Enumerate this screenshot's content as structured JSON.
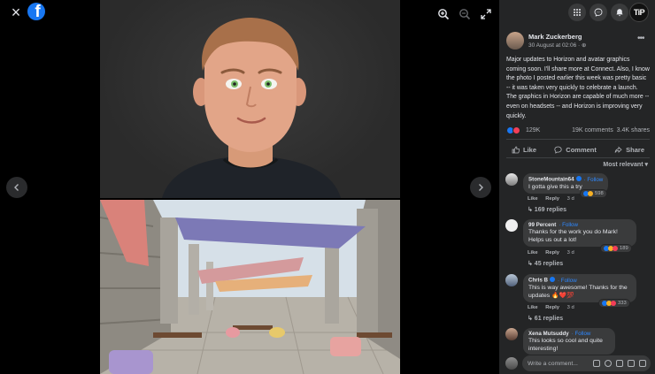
{
  "viewer": {
    "logo_letter": "f",
    "close_icon": "×",
    "tools": [
      "zoom-in-icon",
      "zoom-out-icon",
      "fullscreen-icon"
    ]
  },
  "topbar": {
    "buttons": [
      "menu-grid-icon",
      "messenger-icon",
      "notifications-icon"
    ],
    "account_label": "TiP"
  },
  "post": {
    "author": "Mark Zuckerberg",
    "date": "30 August at 02:06 · ",
    "audience_icon": "globe-icon",
    "more_icon": "•••",
    "text": "Major updates to Horizon and avatar graphics coming soon. I'll share more at Connect. Also, I know the photo I posted earlier this week was pretty basic -- it was taken very quickly to celebrate a launch. The graphics in Horizon are capable of much more -- even on headsets -- and Horizon is improving very quickly.",
    "reaction_count": "129K",
    "comments_count": "19K comments",
    "shares_count": "3.4K shares"
  },
  "actions": {
    "like": "Like",
    "comment": "Comment",
    "share": "Share"
  },
  "sort_label": "Most relevant ▾",
  "comments": [
    {
      "name": "StoneMountain64",
      "follow": "· Follow",
      "text": "I gotta give this a try",
      "reactions": "598",
      "like": "Like",
      "reply": "Reply",
      "time": "3 d",
      "replies": "↳ 169 replies"
    },
    {
      "name": "99 Percent",
      "follow": "· Follow",
      "text": "Thanks for the work you do Mark! Helps us out a lot!",
      "reactions": "189",
      "like": "Like",
      "reply": "Reply",
      "time": "3 d",
      "replies": "↳ 45 replies"
    },
    {
      "name": "Chris B",
      "follow": "· Follow",
      "text": "This is way awesome! Thanks for the updates 🔥❤️💯",
      "reactions": "333",
      "like": "Like",
      "reply": "Reply",
      "time": "3 d",
      "replies": "↳ 61 replies"
    },
    {
      "name": "Xena Mutsuddy",
      "follow": "· Follow",
      "text": "This looks so cool and quite interesting!"
    }
  ],
  "composer": {
    "placeholder": "Write a comment..."
  },
  "colors": {
    "accent": "#1877f2",
    "panel": "#242526",
    "bubble": "#3a3b3c"
  }
}
